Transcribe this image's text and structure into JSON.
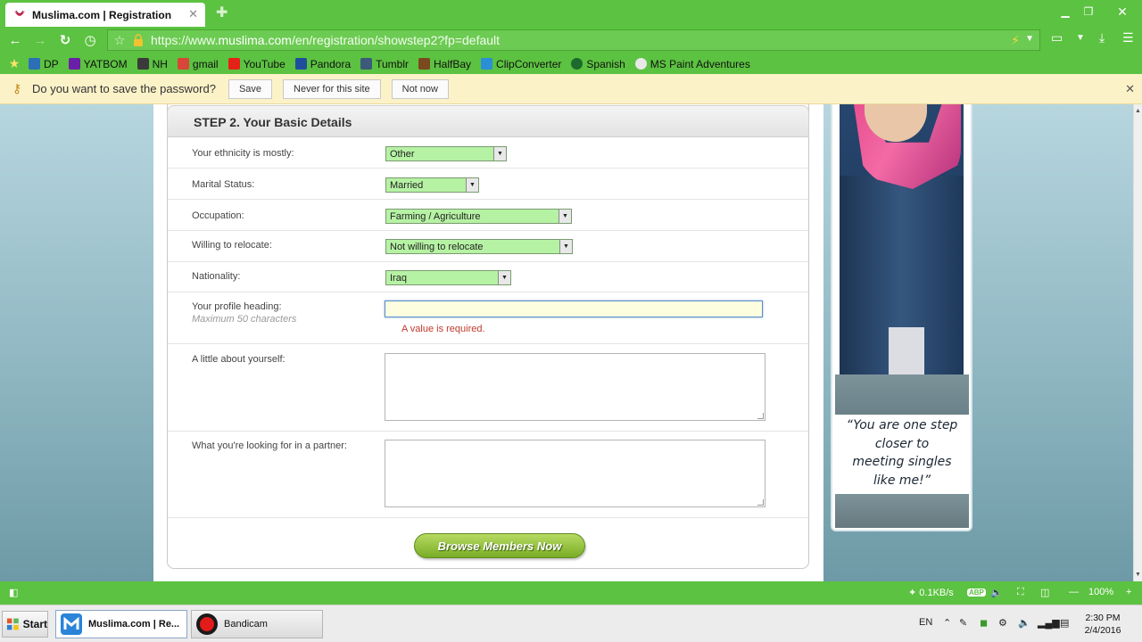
{
  "browser": {
    "tab_title": "Muslima.com | Registration",
    "url_prefix": "https://www.",
    "url_domain": "muslima.com",
    "url_path": "/en/registration/showstep2?fp=default"
  },
  "bookmarks": [
    "DP",
    "YATBOM",
    "NH",
    "gmail",
    "YouTube",
    "Pandora",
    "Tumblr",
    "HalfBay",
    "ClipConverter",
    "Spanish",
    "MS Paint Adventures"
  ],
  "password_bar": {
    "question": "Do you want to save the password?",
    "save": "Save",
    "never": "Never for this site",
    "not_now": "Not now"
  },
  "form": {
    "step_title": "STEP 2. Your Basic Details",
    "ethnicity_label": "Your ethnicity is mostly:",
    "ethnicity_value": "Other",
    "marital_label": "Marital Status:",
    "marital_value": "Married",
    "occupation_label": "Occupation:",
    "occupation_value": "Farming / Agriculture",
    "relocate_label": "Willing to relocate:",
    "relocate_value": "Not willing to relocate",
    "nationality_label": "Nationality:",
    "nationality_value": "Iraq",
    "heading_label": "Your profile heading:",
    "heading_hint": "Maximum 50 characters",
    "heading_value": "",
    "heading_error": "A value is required.",
    "about_label": "A little about yourself:",
    "partner_label": "What you're looking for in a partner:",
    "browse_button": "Browse Members Now"
  },
  "promo": {
    "quote_line1": "“You are one step",
    "quote_line2": "closer to",
    "quote_line3": "meeting singles",
    "quote_line4": "like me!”"
  },
  "statusbar": {
    "speed": "0.1KB/s",
    "zoom": "100%"
  },
  "taskbar": {
    "start": "Start",
    "task1": "Muslima.com | Re...",
    "task2": "Bandicam",
    "lang": "EN",
    "time": "2:30 PM",
    "date": "2/4/2016"
  },
  "colors": {
    "chrome_green": "#5cc241",
    "select_green": "#b6f2a4",
    "button_green": "#79ad26",
    "error_red": "#c0392b"
  }
}
